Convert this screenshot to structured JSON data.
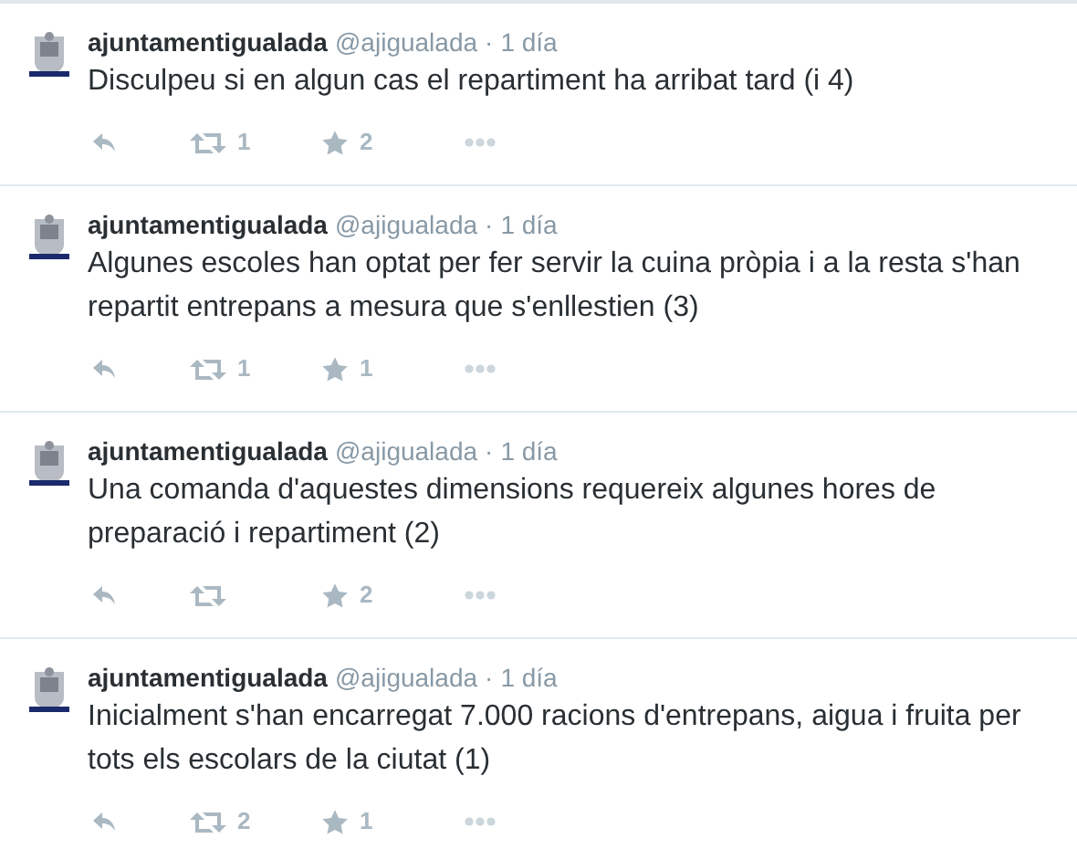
{
  "tweets": [
    {
      "name": "ajuntamentigualada",
      "handle": "@ajigualada",
      "separator": "·",
      "time": "1 día",
      "text": "Disculpeu si en algun cas el repartiment ha arribat tard (i 4)",
      "retweets": "1",
      "favorites": "2"
    },
    {
      "name": "ajuntamentigualada",
      "handle": "@ajigualada",
      "separator": "·",
      "time": "1 día",
      "text": "Algunes escoles han optat per fer servir la cuina pròpia i a la resta s'han repartit entrepans a mesura que s'enllestien (3)",
      "retweets": "1",
      "favorites": "1"
    },
    {
      "name": "ajuntamentigualada",
      "handle": "@ajigualada",
      "separator": "·",
      "time": "1 día",
      "text": "Una comanda d'aquestes dimensions requereix algunes hores de preparació i repartiment (2)",
      "favorites": "2"
    },
    {
      "name": "ajuntamentigualada",
      "handle": "@ajigualada",
      "separator": "·",
      "time": "1 día",
      "text": "Inicialment s'han encarregat 7.000 racions d'entrepans, aigua i fruita per tots els escolars de la ciutat (1)",
      "retweets": "2",
      "favorites": "1"
    }
  ]
}
